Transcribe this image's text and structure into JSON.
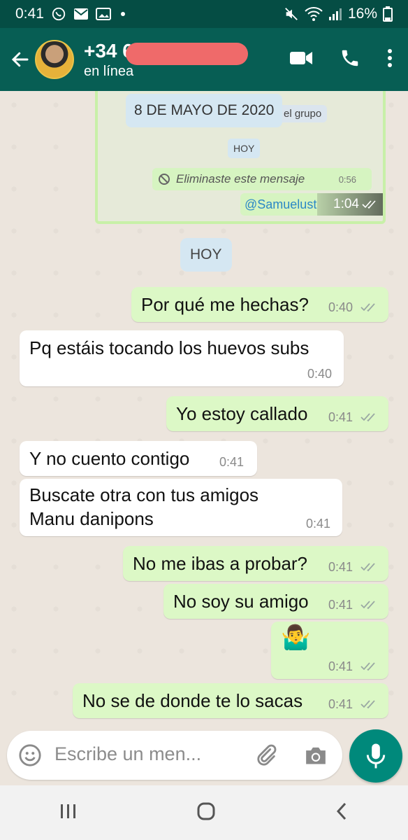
{
  "status_bar": {
    "time": "0:41",
    "battery": "16%",
    "icons": [
      "whatsapp-icon",
      "mail-icon",
      "image-icon",
      "dot",
      "mute-icon",
      "wifi-icon",
      "signal-icon",
      "battery-icon"
    ]
  },
  "header": {
    "contact_number": "+34 6",
    "status": "en línea",
    "actions": [
      "video-call-icon",
      "phone-icon",
      "more-vert-icon"
    ]
  },
  "quoted_screenshot": {
    "date_label": "8 DE MAYO DE 2020",
    "group_fragment": "el grupo",
    "day_label": "HOY",
    "deleted_text": "Eliminaste este mensaje",
    "deleted_time": "0:56",
    "mention": "@Samuelust",
    "overlay_time": "1:04"
  },
  "day_chip": "HOY",
  "messages": [
    {
      "dir": "out",
      "text": "Por qué me hechas?",
      "time": "0:40"
    },
    {
      "dir": "in",
      "text": "Pq estáis tocando los huevos subs",
      "time": "0:40"
    },
    {
      "dir": "out",
      "text": "Yo estoy callado",
      "time": "0:41"
    },
    {
      "dir": "in",
      "text": "Y no cuento contigo",
      "time": "0:41"
    },
    {
      "dir": "in",
      "text_line1": "Buscate otra con tus amigos",
      "text_line2": "Manu danipons",
      "time": "0:41"
    },
    {
      "dir": "out",
      "text": "No me ibas a probar?",
      "time": "0:41"
    },
    {
      "dir": "out",
      "text": "No soy su amigo",
      "time": "0:41"
    },
    {
      "dir": "out",
      "emoji": "🤷‍♂️",
      "time": "0:41"
    },
    {
      "dir": "out",
      "text": "No se de donde te lo sacas",
      "time": "0:41"
    }
  ],
  "composer": {
    "placeholder": "Escribe un men...",
    "icons": [
      "emoji-icon",
      "attach-icon",
      "camera-icon",
      "mic-icon"
    ]
  },
  "nav": [
    "recents-icon",
    "home-icon",
    "back-icon"
  ],
  "colors": {
    "header": "#075e54",
    "status_bar": "#054d44",
    "outgoing": "#dcf8c6",
    "incoming": "#ffffff",
    "accent": "#00897b",
    "read_ticks": "#9aa8a3"
  }
}
